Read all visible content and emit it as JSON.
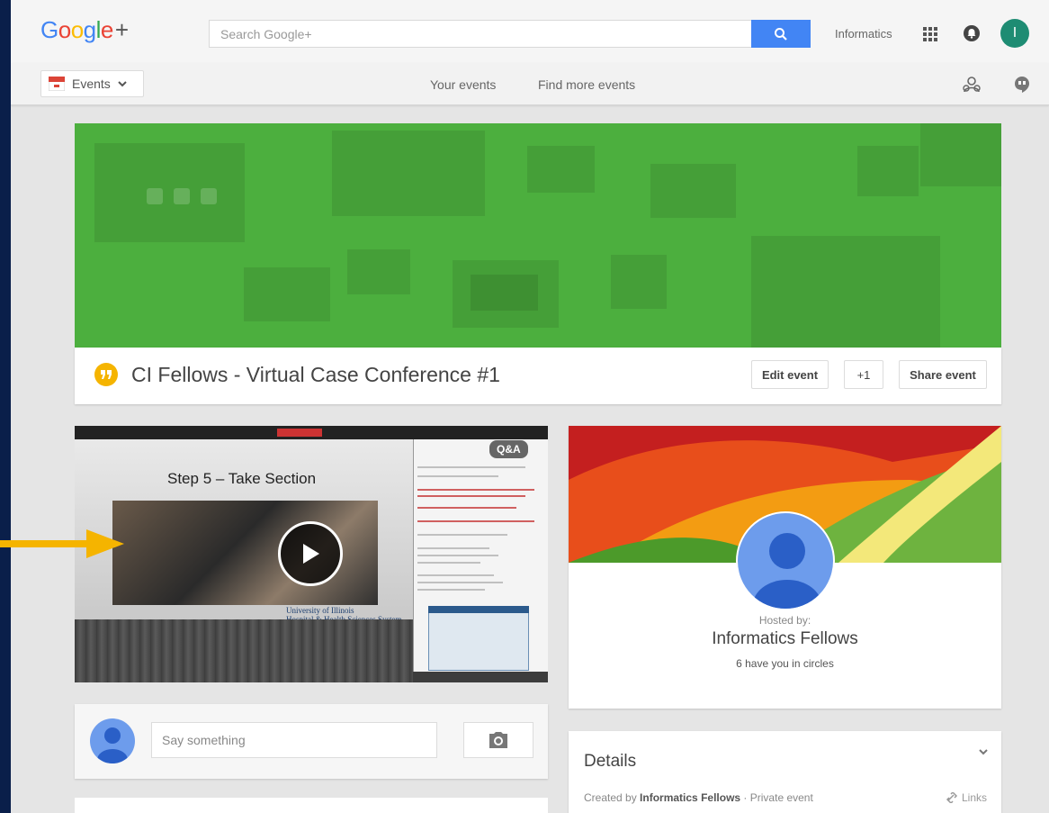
{
  "header": {
    "logo_text": "Google+",
    "search_placeholder": "Search Google+",
    "account_name": "Informatics",
    "avatar_initial": "I"
  },
  "subnav": {
    "section_label": "Events",
    "links": [
      "Your events",
      "Find more events"
    ]
  },
  "event": {
    "title": "CI Fellows - Virtual Case Conference #1",
    "buttons": {
      "edit": "Edit event",
      "plus_one": "+1",
      "share": "Share event"
    }
  },
  "video": {
    "slide_title": "Step 5 – Take Section",
    "badge": "Q&A",
    "university_line1": "University of Illinois",
    "university_line2": "Hospital & Health Sciences System"
  },
  "comment": {
    "placeholder": "Say something"
  },
  "host": {
    "hosted_by_label": "Hosted by:",
    "name": "Informatics Fellows",
    "circles_text": "6 have you in circles"
  },
  "details": {
    "title": "Details",
    "created_by_prefix": "Created by",
    "created_by_name": "Informatics Fellows",
    "separator": "·",
    "privacy": "Private event",
    "links_label": "Links"
  },
  "colors": {
    "banner_green": "#4caf3e",
    "accent_blue": "#4285f4",
    "hangouts_yellow": "#f5b400",
    "annotation_arrow": "#f5b400"
  }
}
